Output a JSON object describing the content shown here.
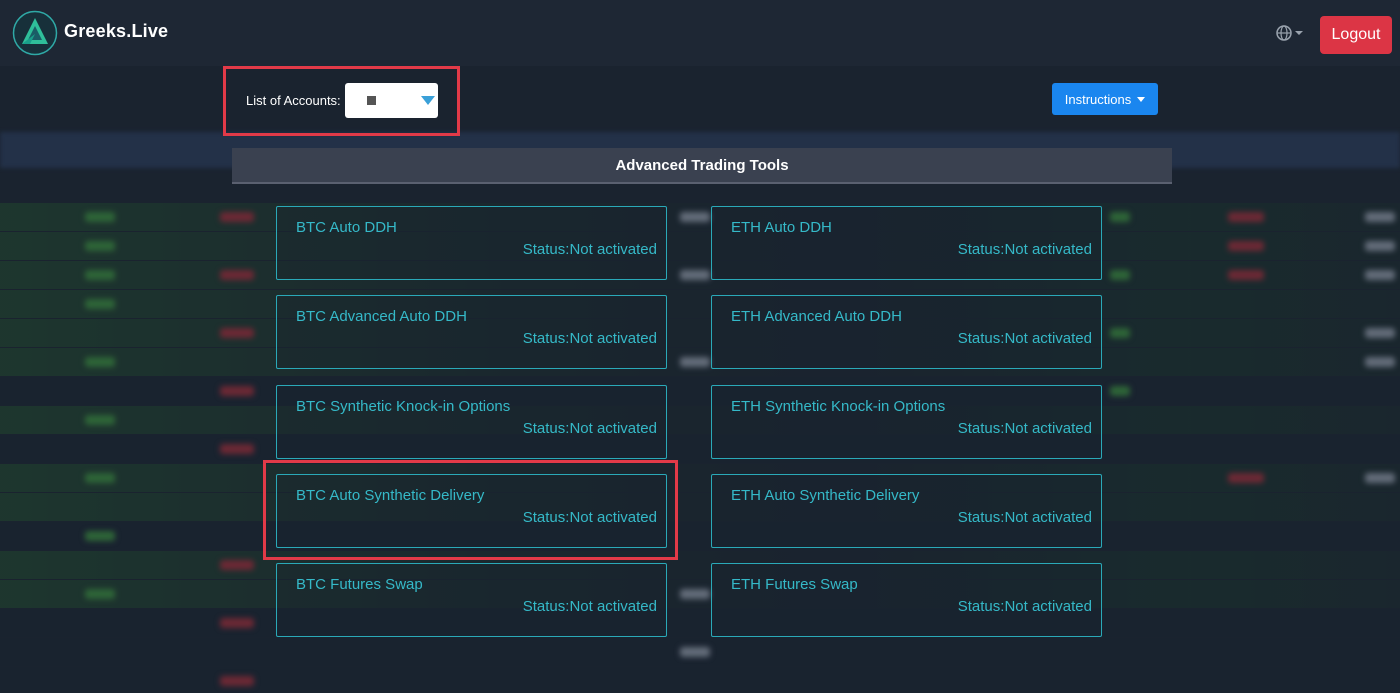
{
  "header": {
    "brand": "Greeks.Live",
    "logout_label": "Logout",
    "icons": {
      "logo": "greeks-live-logo",
      "language": "globe-icon"
    }
  },
  "accounts": {
    "label": "List of Accounts:"
  },
  "instructions": {
    "label": "Instructions"
  },
  "section": {
    "title": "Advanced Trading Tools"
  },
  "tools": {
    "btc": [
      {
        "name": "BTC Auto DDH",
        "status": "Status:Not activated"
      },
      {
        "name": "BTC Advanced Auto DDH",
        "status": "Status:Not activated"
      },
      {
        "name": "BTC Synthetic Knock-in Options",
        "status": "Status:Not activated"
      },
      {
        "name": "BTC Auto Synthetic Delivery",
        "status": "Status:Not activated"
      },
      {
        "name": "BTC Futures Swap",
        "status": "Status:Not activated"
      }
    ],
    "eth": [
      {
        "name": "ETH Auto DDH",
        "status": "Status:Not activated"
      },
      {
        "name": "ETH Advanced Auto DDH",
        "status": "Status:Not activated"
      },
      {
        "name": "ETH Synthetic Knock-in Options",
        "status": "Status:Not activated"
      },
      {
        "name": "ETH Auto Synthetic Delivery",
        "status": "Status:Not activated"
      },
      {
        "name": "ETH Futures Swap",
        "status": "Status:Not activated"
      }
    ]
  },
  "colors": {
    "accent_teal": "#35b9c8",
    "logout_red": "#dc3545",
    "instructions_blue": "#1a86ef",
    "highlight_red": "#e23a48",
    "background": "#1c2532"
  }
}
